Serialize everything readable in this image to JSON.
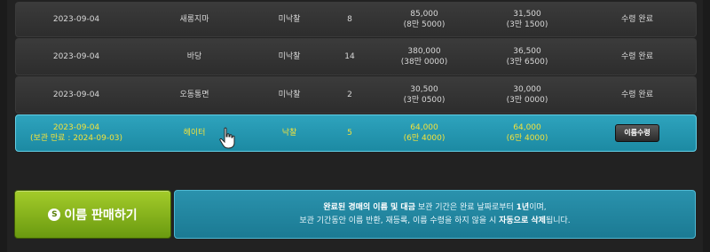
{
  "rows": [
    {
      "date": "2023-09-04",
      "date_note": "",
      "name": "새롱지마",
      "state": "미낙찰",
      "count": "8",
      "price": "85,000",
      "price_sub": "(8만 5000)",
      "sale": "31,500",
      "sale_sub": "(3만 1500)",
      "status": "수령 완료"
    },
    {
      "date": "2023-09-04",
      "date_note": "",
      "name": "바당",
      "state": "미낙찰",
      "count": "14",
      "price": "380,000",
      "price_sub": "(38만 0000)",
      "sale": "36,500",
      "sale_sub": "(3만 6500)",
      "status": "수령 완료"
    },
    {
      "date": "2023-09-04",
      "date_note": "",
      "name": "오동통면",
      "state": "미낙찰",
      "count": "2",
      "price": "30,500",
      "price_sub": "(3만 0500)",
      "sale": "30,000",
      "sale_sub": "(3만 0000)",
      "status": "수령 완료"
    },
    {
      "date": "2023-09-04",
      "date_note": "(보관 만료 : 2024-09-03)",
      "name": "헤이터",
      "state": "낙찰",
      "count": "5",
      "price": "64,000",
      "price_sub": "(6만 4000)",
      "sale": "64,000",
      "sale_sub": "(6만 4000)",
      "status": "이름수령"
    }
  ],
  "sell_button": {
    "label": "이름 판매하기",
    "icon": "S"
  },
  "notice": {
    "l1_a": "완료된 경매의 이름 및 대금",
    "l1_b": " 보관 기간은 완료 날짜로부터 ",
    "l1_c": "1년",
    "l1_d": "이며,",
    "l2_a": "보관 기간동안 이름 반환, 재등록, 이름 수령을 하지 않을 시 ",
    "l2_b": "자동으로 삭제",
    "l2_c": "됩니다."
  },
  "colors": {
    "selected_row": "#2ea3bd",
    "selected_text": "#f3e23c",
    "sell_button": "#8dba1e",
    "notice_bg": "#2389a3"
  }
}
